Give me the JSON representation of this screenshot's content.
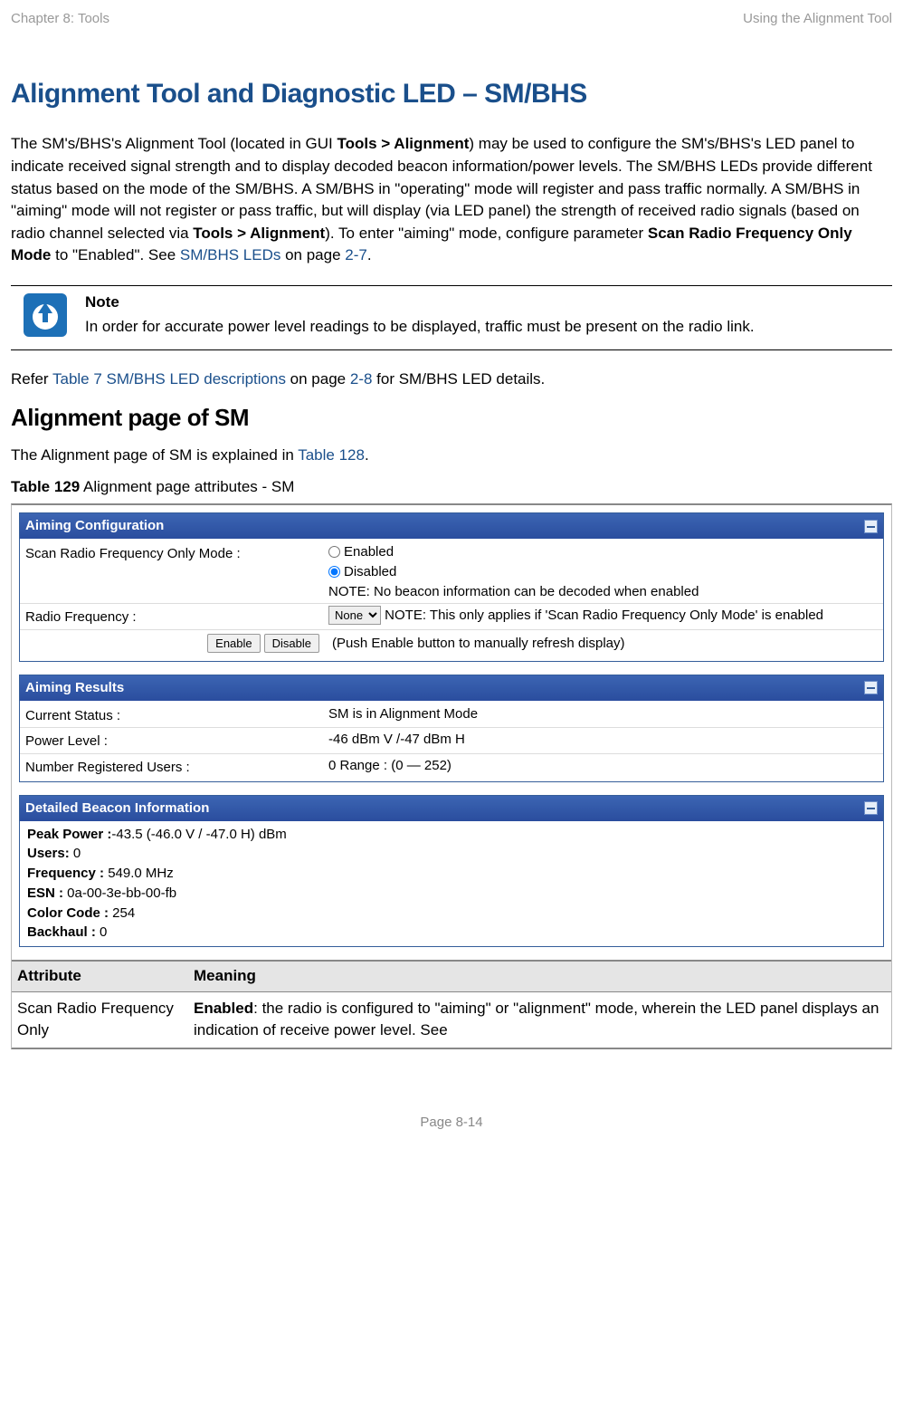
{
  "header": {
    "left": "Chapter 8:  Tools",
    "right": "Using the Alignment Tool"
  },
  "title": "Alignment Tool and Diagnostic LED – SM/BHS",
  "intro": {
    "seg1": "The SM's/BHS's Alignment Tool (located in GUI ",
    "bold1": "Tools > Alignment",
    "seg2": ") may be used to configure the SM's/BHS's LED panel to indicate received signal strength and to display decoded beacon information/power levels.  The SM/BHS LEDs provide different status based on the mode of the SM/BHS. A SM/BHS in \"operating\" mode will register and pass traffic normally. A SM/BHS in \"aiming\" mode will not register or pass traffic, but will display (via LED panel) the strength of received radio signals (based on radio channel selected via ",
    "bold2": "Tools > Alignment",
    "seg3": ").  To enter \"aiming\" mode, configure parameter ",
    "bold3": "Scan Radio Frequency Only Mode",
    "seg4": " to \"Enabled\". See ",
    "link1": "SM/BHS LEDs",
    "seg5": " on page ",
    "link2": "2-7",
    "seg6": "."
  },
  "note": {
    "label": "Note",
    "text": "In order for accurate power level readings to be displayed, traffic must be present on the radio link."
  },
  "refer": {
    "pre": "Refer ",
    "link1": "Table 7 SM/BHS LED descriptions",
    "mid": " on page ",
    "link2": "2-8",
    "post": " for SM/BHS LED details."
  },
  "subheading": "Alignment page of SM",
  "subpara": {
    "pre": "The Alignment page of SM is explained in ",
    "link": "Table 128",
    "post": "."
  },
  "table_caption": {
    "bold": "Table 129",
    "rest": "  Alignment page attributes - SM"
  },
  "aiming_config": {
    "title": "Aiming Configuration",
    "rows": {
      "scan_label": "Scan Radio Frequency Only Mode :",
      "scan_enabled": "Enabled",
      "scan_disabled": "Disabled",
      "scan_note": "NOTE: No beacon information can be decoded when enabled",
      "rf_label": "Radio Frequency :",
      "rf_select": "None",
      "rf_note": "NOTE: This only applies if 'Scan Radio Frequency Only Mode' is enabled"
    },
    "buttons": {
      "enable": "Enable",
      "disable": "Disable"
    },
    "button_note": "(Push Enable button to manually refresh display)"
  },
  "aiming_results": {
    "title": "Aiming Results",
    "rows": [
      {
        "label": "Current Status :",
        "value": "SM is in Alignment Mode"
      },
      {
        "label": "Power Level :",
        "value": "-46 dBm V /-47 dBm H"
      },
      {
        "label": "Number Registered Users :",
        "value": "0 Range : (0 — 252)"
      }
    ]
  },
  "detailed_beacon": {
    "title": "Detailed Beacon Information",
    "lines": [
      {
        "b": "Peak Power :",
        "t": "-43.5 (-46.0 V / -47.0 H) dBm"
      },
      {
        "b": "Users:",
        "t": " 0"
      },
      {
        "b": "Frequency :",
        "t": " 549.0 MHz"
      },
      {
        "b": "ESN :",
        "t": " 0a-00-3e-bb-00-fb"
      },
      {
        "b": "Color Code :",
        "t": " 254"
      },
      {
        "b": "Backhaul :",
        "t": " 0"
      }
    ]
  },
  "attr_table": {
    "headers": {
      "attribute": "Attribute",
      "meaning": "Meaning"
    },
    "row": {
      "attribute": "Scan Radio Frequency Only",
      "meaning_bold": "Enabled",
      "meaning_rest": ": the radio is configured to \"aiming\" or \"alignment\" mode, wherein the LED panel displays an indication of receive power level.  See"
    }
  },
  "footer": "Page 8-14"
}
